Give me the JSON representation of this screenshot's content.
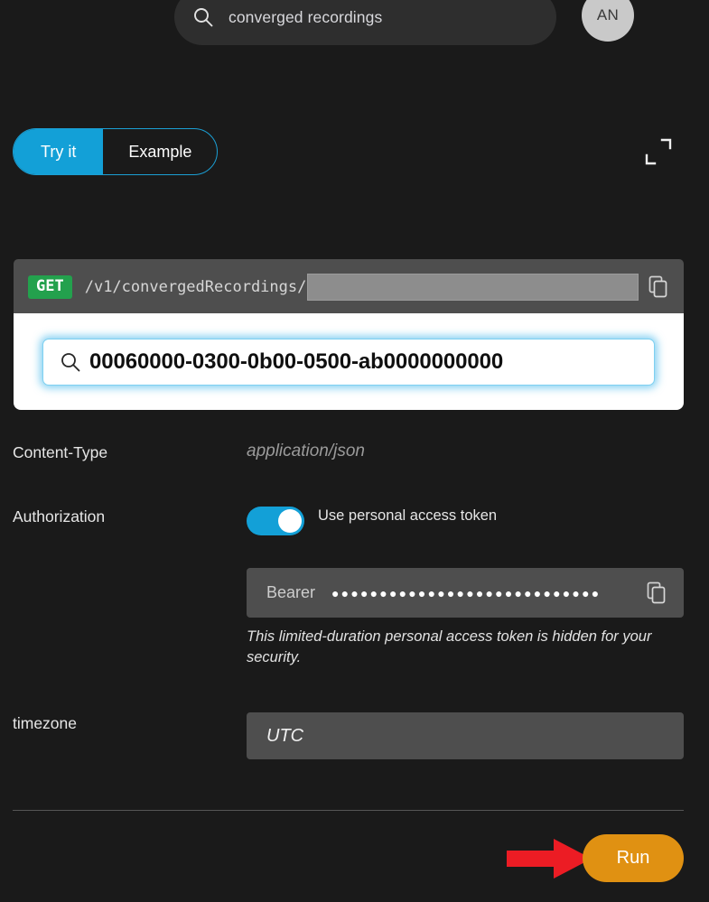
{
  "topbar": {
    "search_icon": "search-icon",
    "search_value": "converged recordings",
    "search_placeholder": "Search",
    "avatar_initials": "AN"
  },
  "tabs": {
    "active_label": "Try it",
    "inactive_label": "Example",
    "expand_icon": "expand-icon",
    "accent_color": "#13a0d7"
  },
  "endpoint": {
    "method": "GET",
    "path": "/v1/convergedRecordings/",
    "path_param_value": "",
    "path_param_placeholder": "",
    "copy_icon": "copy-icon",
    "method_color": "#23a14d"
  },
  "suggestion": {
    "search_icon": "search-icon",
    "value": "00060000-0300-0b00-0500-ab0000000000",
    "focus_color": "#46b9eb"
  },
  "params": {
    "content_type": {
      "label": "Content-Type",
      "placeholder": "application/json",
      "value": ""
    },
    "authorization": {
      "label": "Authorization",
      "toggle_label": "Use personal access token",
      "toggle_on": true,
      "bearer_label": "Bearer",
      "bearer_masked": "●●●●●●●●●●●●●●●●●●●●●●●●●●●●",
      "copy_icon": "copy-icon",
      "note": "This limited-duration personal access token is hidden for your security."
    },
    "timezone": {
      "label": "timezone",
      "placeholder": "UTC",
      "value": ""
    }
  },
  "footer": {
    "run_label": "Run",
    "run_color": "#e09112",
    "arrow_icon": "red-arrow-icon",
    "arrow_color": "#ec1c24"
  }
}
